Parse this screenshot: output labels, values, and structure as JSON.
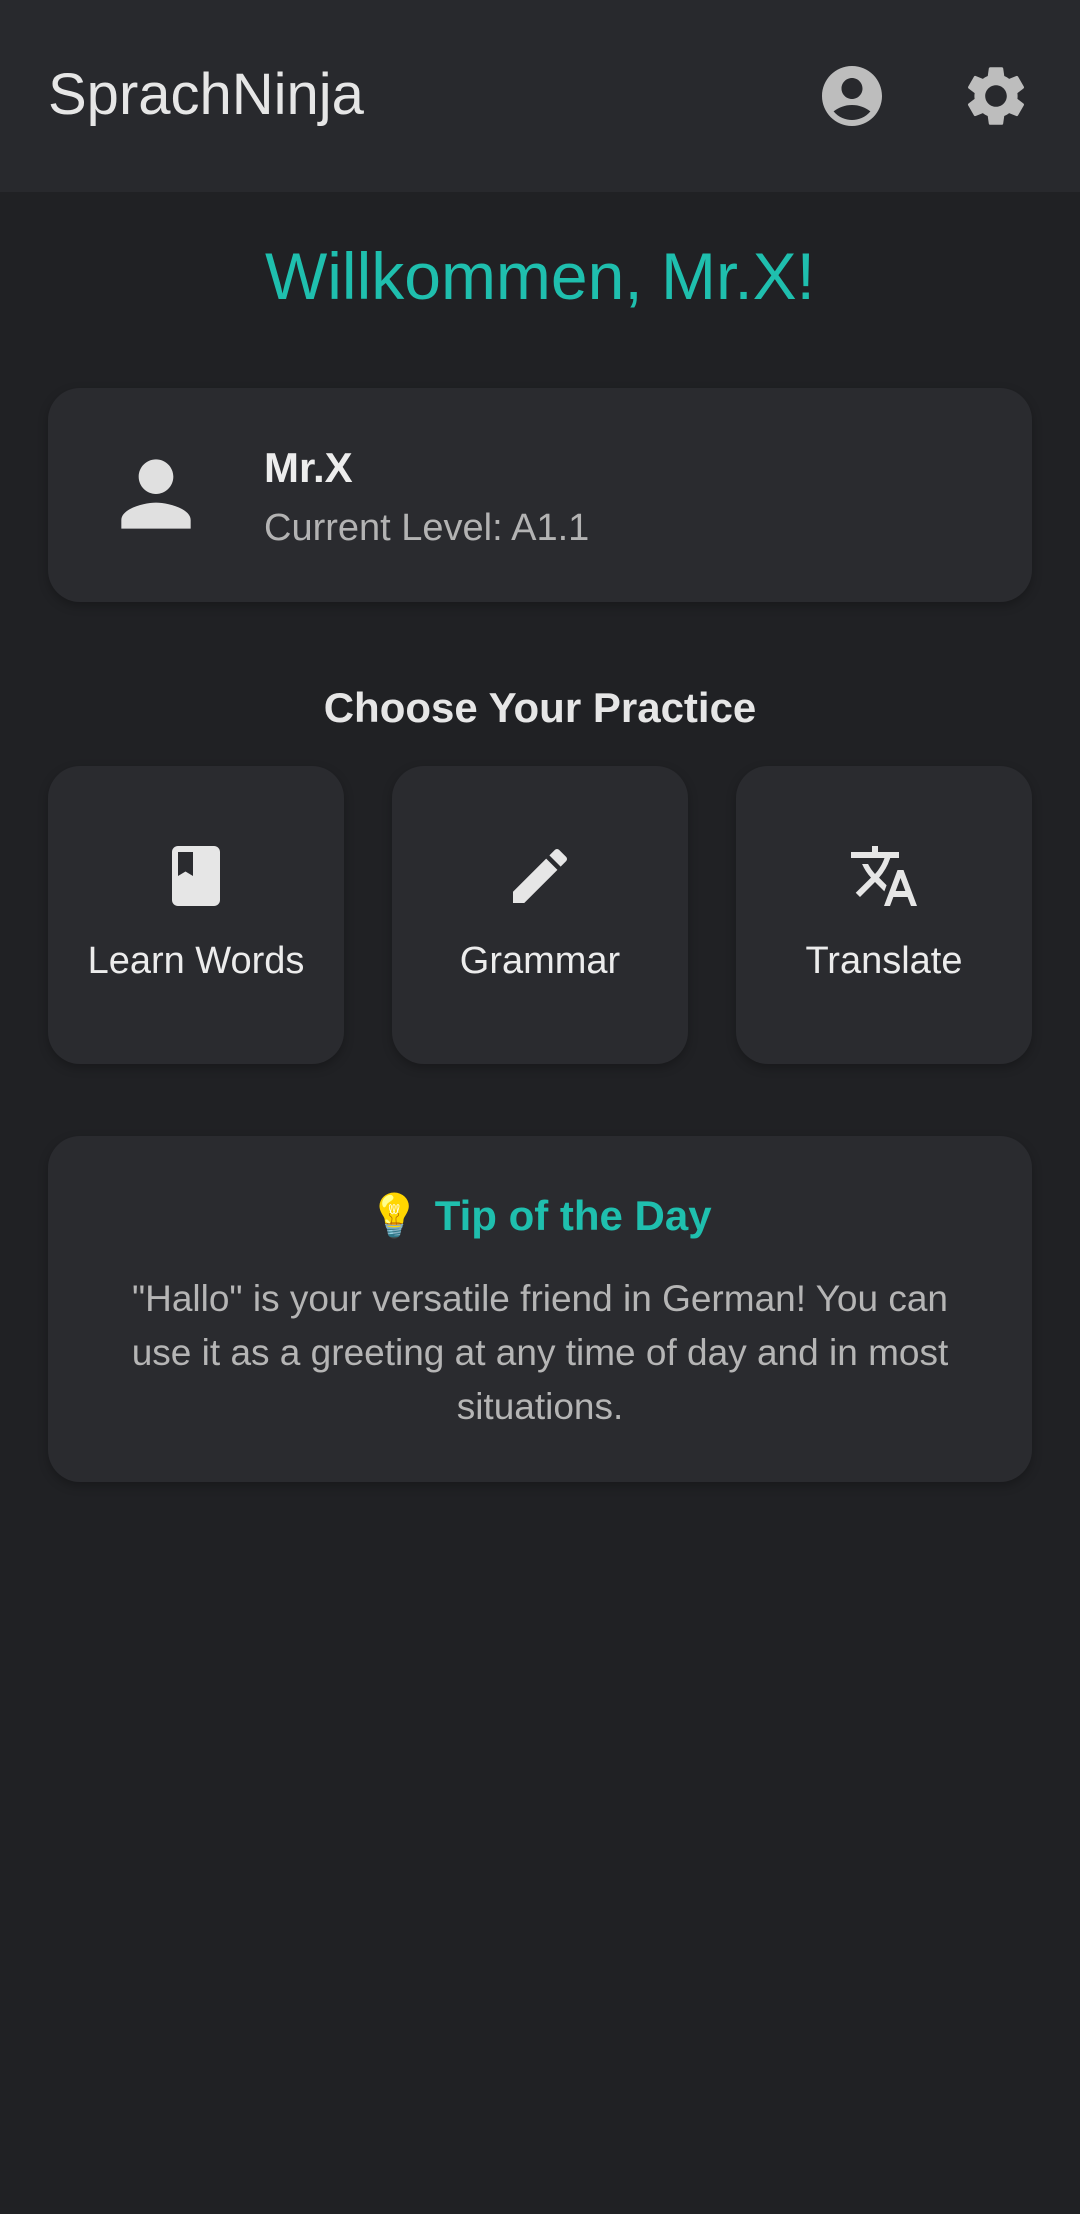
{
  "app": {
    "title": "SprachNinja",
    "accent_color": "#1fbfae",
    "background_color": "#202124"
  },
  "header": {
    "account_icon": "account-circle-icon",
    "settings_icon": "gear-icon"
  },
  "welcome": {
    "text": "Willkommen, Mr.X!"
  },
  "profile": {
    "avatar_icon": "person-icon",
    "name": "Mr.X",
    "level": "Current Level: A1.1"
  },
  "practice": {
    "heading": "Choose Your Practice",
    "items": [
      {
        "label": "Learn Words",
        "icon": "book-icon"
      },
      {
        "label": "Grammar",
        "icon": "pencil-icon"
      },
      {
        "label": "Translate",
        "icon": "translate-icon"
      }
    ]
  },
  "tip": {
    "emoji": "💡",
    "title": "Tip of the Day",
    "text": "\"Hallo\" is your versatile friend in German! You can use it as a greeting at any time of day and in most situations."
  }
}
